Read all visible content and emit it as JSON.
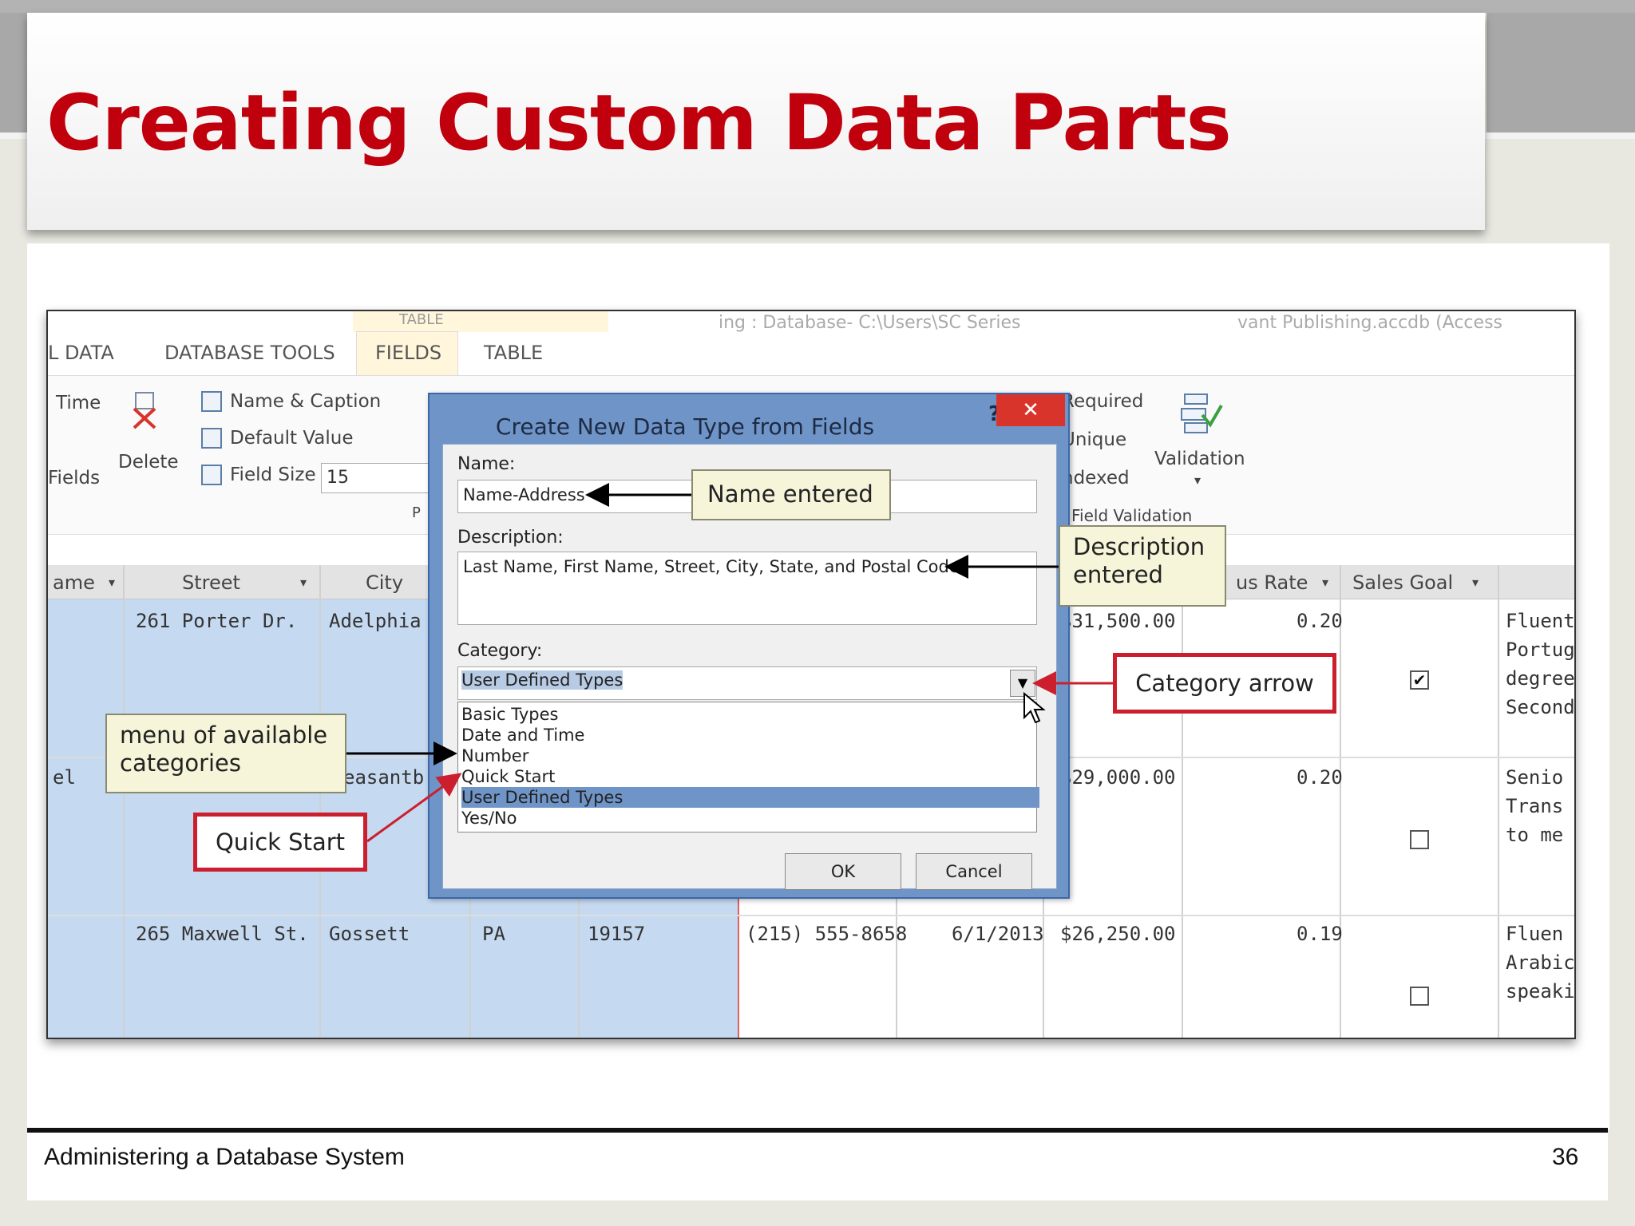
{
  "slide": {
    "title": "Creating Custom Data Parts",
    "footer": "Administering a Database System",
    "page_number": "36",
    "title_color": "#c0000c"
  },
  "window": {
    "title_fragment_left": "TABLE",
    "title_fragment_mid": "ing : Database- C:\\Users\\SC Series",
    "title_fragment_right": "vant Publishing.accdb (Access"
  },
  "ribbon": {
    "tabs": [
      "L DATA",
      "DATABASE TOOLS",
      "FIELDS",
      "TABLE"
    ],
    "active_tab": "FIELDS",
    "time_label": "Time",
    "fields_label": "Fields",
    "delete_label": "Delete",
    "name_caption": "Name & Caption",
    "default_value": "Default Value",
    "field_size_label": "Field Size",
    "field_size_value": "15",
    "props_fragment": "P",
    "required": "Required",
    "unique": "Unique",
    "indexed": "ndexed",
    "validation": "Validation",
    "field_validation": "Field Validation"
  },
  "grid": {
    "headers": [
      "ame",
      "Street",
      "City",
      "us Rate",
      "Sales Goal"
    ],
    "rows": [
      {
        "street": "261 Porter Dr.",
        "city": "Adelphia",
        "amount": "$31,500.00",
        "rate": "0.20",
        "goal_checked": true,
        "note": [
          "Fluent",
          "Portugu",
          "degree",
          "Second"
        ]
      },
      {
        "name_frag": "el",
        "street": "easantb",
        "amount": "$29,000.00",
        "rate": "0.20",
        "goal_checked": false,
        "note": [
          "Senio",
          "Trans",
          "to me"
        ]
      },
      {
        "street": "265 Maxwell St.",
        "city": "Gossett",
        "state": "PA",
        "zip": "19157",
        "phone": "(215) 555-8658",
        "date": "6/1/2013",
        "amount": "$26,250.00",
        "rate": "0.19",
        "goal_checked": false,
        "note": [
          "Fluen",
          "Arabic",
          "speaki"
        ]
      }
    ]
  },
  "dialog": {
    "title": "Create New Data Type from Fields",
    "help": "?",
    "close": "✕",
    "name_label": "Name:",
    "name_value": "Name-Address",
    "description_label": "Description:",
    "description_value": "Last Name, First Name, Street, City, State, and Postal Code",
    "category_label": "Category:",
    "category_value": "User Defined Types",
    "category_options": [
      "Basic Types",
      "Date and Time",
      "Number",
      "Quick Start",
      "User Defined Types",
      "Yes/No"
    ],
    "selected_index": 4,
    "ok": "OK",
    "cancel": "Cancel"
  },
  "callouts": {
    "name_entered": "Name entered",
    "description_entered": [
      "Description",
      "entered"
    ],
    "category_arrow": "Category arrow",
    "menu_categories": [
      "menu of available",
      "categories"
    ],
    "quick_start": "Quick Start"
  }
}
